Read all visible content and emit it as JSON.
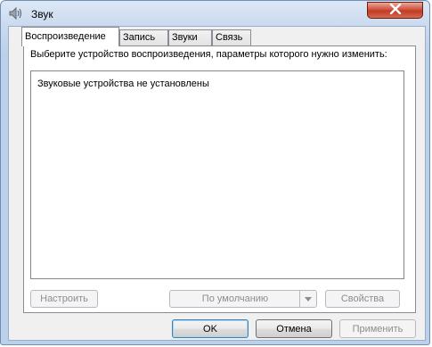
{
  "window": {
    "title": "Звук",
    "icon": "speaker-icon",
    "close_icon": "close-icon"
  },
  "tabs": [
    {
      "label": "Воспроизведение",
      "active": true
    },
    {
      "label": "Запись",
      "active": false
    },
    {
      "label": "Звуки",
      "active": false
    },
    {
      "label": "Связь",
      "active": false
    }
  ],
  "playback": {
    "instruction": "Выберите устройство воспроизведения, параметры которого нужно изменить:",
    "empty_message": "Звуковые устройства не установлены",
    "buttons": {
      "configure": "Настроить",
      "set_default": "По умолчанию",
      "properties": "Свойства"
    }
  },
  "footer": {
    "ok": "OK",
    "cancel": "Отмена",
    "apply": "Применить"
  },
  "colors": {
    "close_button": "#c13a24",
    "frame": "#bcd0ea",
    "client": "#f0f0f0"
  }
}
